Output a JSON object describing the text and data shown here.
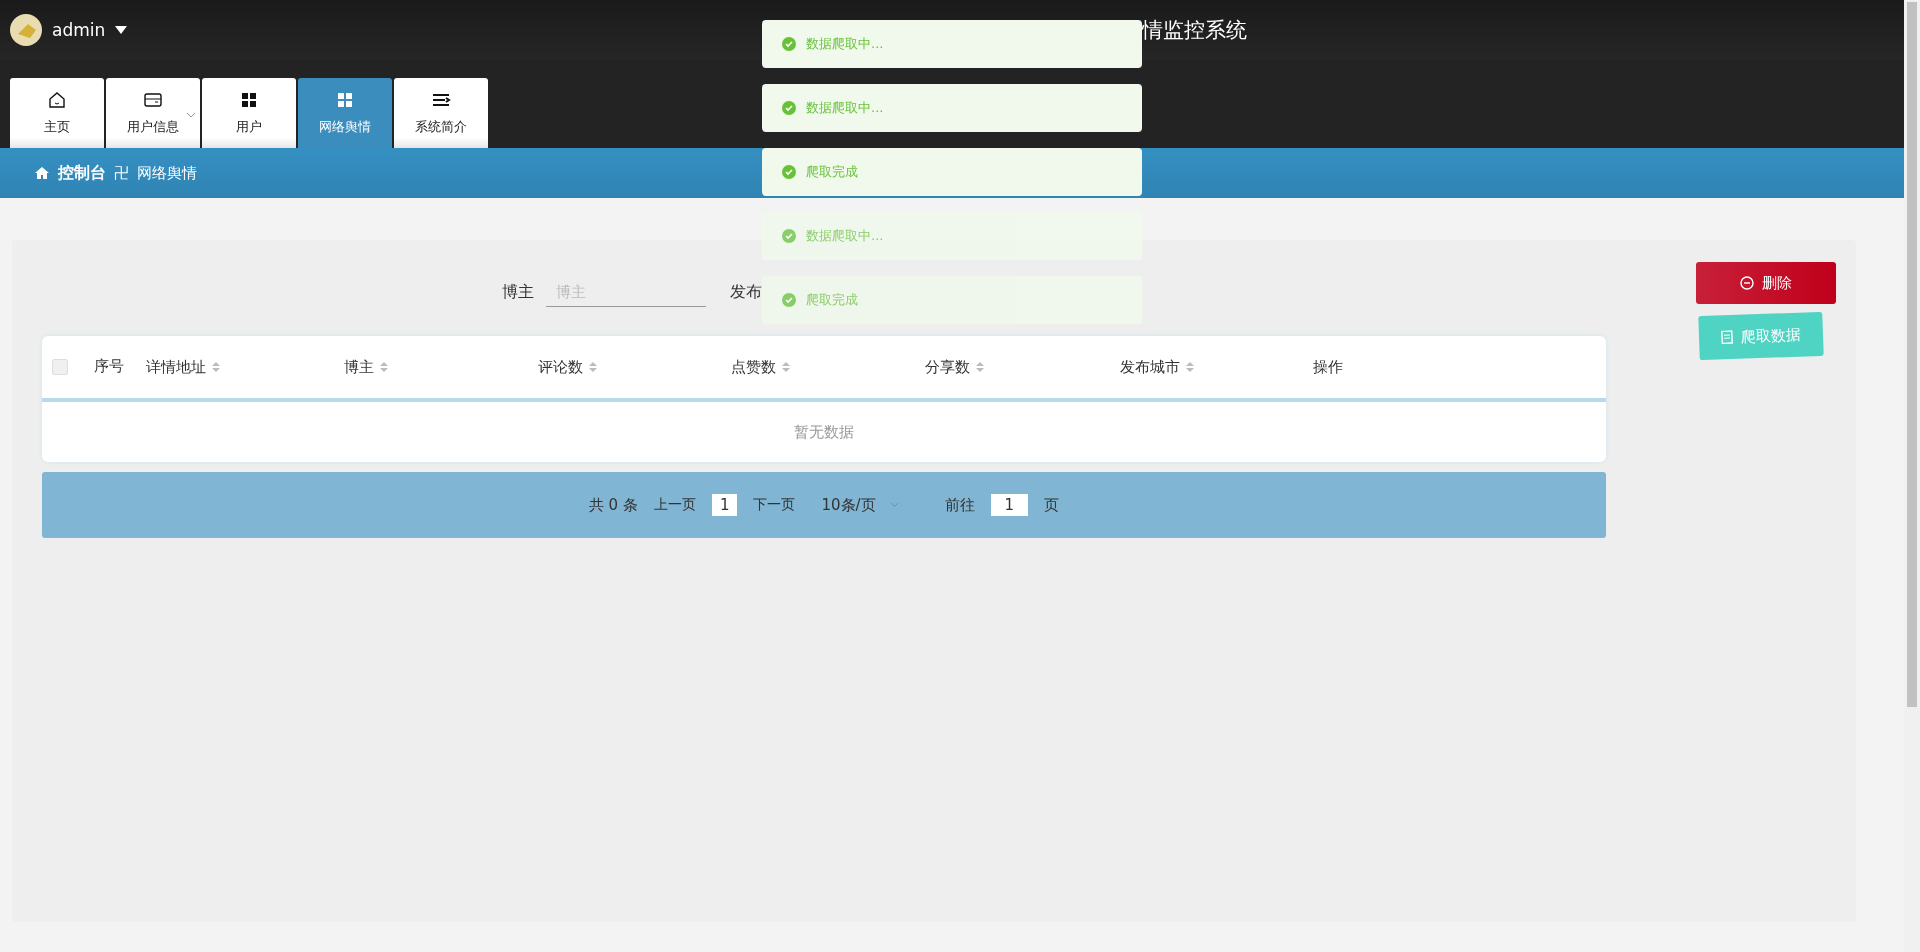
{
  "header": {
    "user": "admin",
    "title": "情监控系统"
  },
  "tabs": [
    {
      "label": "主页",
      "kind": "home",
      "selected": false,
      "dropdown": false
    },
    {
      "label": "用户信息",
      "kind": "card",
      "selected": false,
      "dropdown": true
    },
    {
      "label": "用户",
      "kind": "grid",
      "selected": false,
      "dropdown": false
    },
    {
      "label": "网络舆情",
      "kind": "grid",
      "selected": true,
      "dropdown": false
    },
    {
      "label": "系统简介",
      "kind": "lines",
      "selected": false,
      "dropdown": false
    }
  ],
  "breadcrumb": {
    "root": "控制台",
    "separator": "卍",
    "current": "网络舆情"
  },
  "search": {
    "fields": [
      {
        "label": "博主",
        "placeholder": "博主"
      },
      {
        "label": "发布"
      }
    ]
  },
  "actions": [
    {
      "label": "删除",
      "kind": "danger"
    },
    {
      "label": "爬取数据",
      "kind": "crawl"
    }
  ],
  "table": {
    "select_all": {
      "checked": false
    },
    "columns": [
      {
        "label": "序号",
        "sortable": false
      },
      {
        "label": "详情地址",
        "sortable": true
      },
      {
        "label": "博主",
        "sortable": true
      },
      {
        "label": "评论数",
        "sortable": true
      },
      {
        "label": "点赞数",
        "sortable": true
      },
      {
        "label": "分享数",
        "sortable": true
      },
      {
        "label": "发布城市",
        "sortable": true
      },
      {
        "label": "操作",
        "sortable": false
      }
    ],
    "empty": "暂无数据"
  },
  "pagination": {
    "total": "共 0 条",
    "prev": "上一页",
    "page": "1",
    "next": "下一页",
    "size": "10条/页",
    "goto": "前往",
    "goto_value": "1",
    "unit": "页"
  },
  "toasts": [
    {
      "text": "数据爬取中...",
      "faded": false
    },
    {
      "text": "数据爬取中...",
      "faded": false
    },
    {
      "text": "爬取完成",
      "faded": false
    },
    {
      "text": "数据爬取中...",
      "faded": true
    },
    {
      "text": "爬取完成",
      "faded": true
    }
  ]
}
